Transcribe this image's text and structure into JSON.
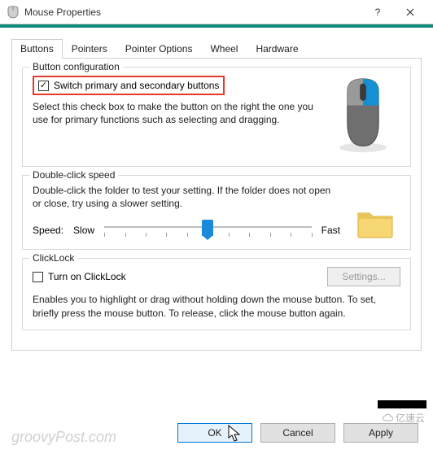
{
  "window": {
    "title": "Mouse Properties",
    "tabs": [
      "Buttons",
      "Pointers",
      "Pointer Options",
      "Wheel",
      "Hardware"
    ],
    "active_tab": 0
  },
  "button_config": {
    "group_label": "Button configuration",
    "switch_label": "Switch primary and secondary buttons",
    "switch_checked": true,
    "desc": "Select this check box to make the button on the right the one you use for primary functions such as selecting and dragging."
  },
  "double_click": {
    "group_label": "Double-click speed",
    "desc": "Double-click the folder to test your setting. If the folder does not open or close, try using a slower setting.",
    "speed_label": "Speed:",
    "slow_label": "Slow",
    "fast_label": "Fast",
    "slider_value": 5,
    "slider_max": 10
  },
  "clicklock": {
    "group_label": "ClickLock",
    "turn_on_label": "Turn on ClickLock",
    "turn_on_checked": false,
    "settings_label": "Settings...",
    "settings_enabled": false,
    "desc": "Enables you to highlight or drag without holding down the mouse button. To set, briefly press the mouse button. To release, click the mouse button again."
  },
  "footer": {
    "ok": "OK",
    "cancel": "Cancel",
    "apply": "Apply"
  },
  "watermark": "groovyPost.com",
  "badge": "亿速云"
}
